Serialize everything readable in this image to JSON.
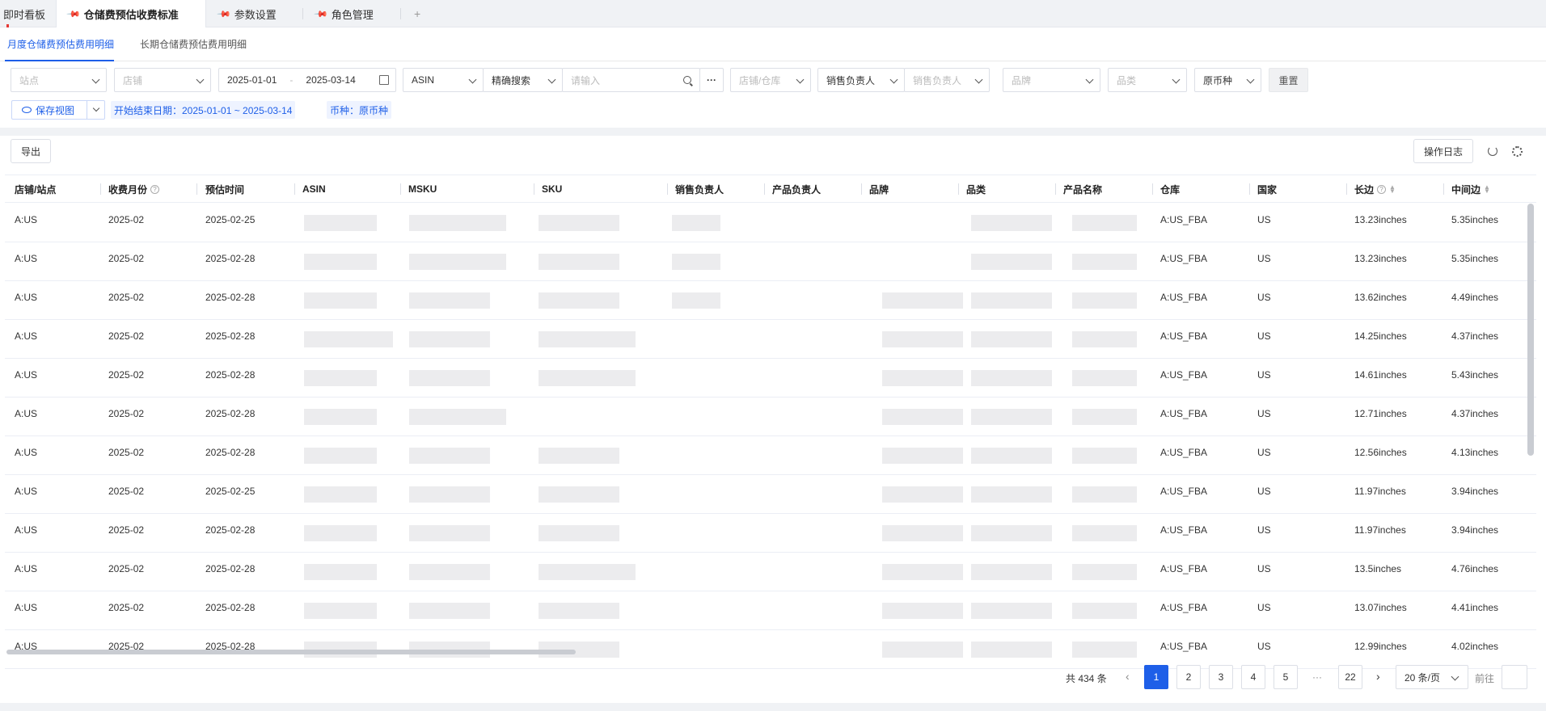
{
  "top_tabs": [
    {
      "label": "即时看板"
    },
    {
      "label": "仓储费预估收费标准"
    },
    {
      "label": "参数设置"
    },
    {
      "label": "角色管理"
    }
  ],
  "add_tab": "+",
  "sub_tabs": [
    {
      "label": "月度仓储费预估费用明细"
    },
    {
      "label": "长期仓储费预估费用明细"
    }
  ],
  "filters": {
    "site_placeholder": "站点",
    "shop_placeholder": "店铺",
    "date_start": "2025-01-01",
    "date_sep": "-",
    "date_end": "2025-03-14",
    "id_type": "ASIN",
    "match_mode": "精确搜索",
    "search_placeholder": "请输入",
    "more": "···",
    "shop_warehouse_placeholder": "店铺/仓库",
    "sales_owner_type": "销售负责人",
    "sales_owner_placeholder": "销售负责人",
    "brand_placeholder": "品牌",
    "category_placeholder": "品类",
    "currency": "原币种",
    "reset_label": "重置"
  },
  "view": {
    "save_view_label": "保存视图",
    "tag_date": "开始结束日期：2025-01-01 ~ 2025-03-14",
    "tag_currency": "币种：原币种"
  },
  "toolbar": {
    "export_label": "导出",
    "log_label": "操作日志"
  },
  "table": {
    "columns": [
      "店铺/站点",
      "收费月份",
      "预估时间",
      "ASIN",
      "MSKU",
      "SKU",
      "销售负责人",
      "产品负责人",
      "品牌",
      "品类",
      "产品名称",
      "仓库",
      "国家",
      "长边",
      "中间边"
    ],
    "rows": [
      {
        "shop": "A:US",
        "month": "2025-02",
        "date": "2025-02-25",
        "warehouse": "A:US_FBA",
        "country": "US",
        "long_side": "13.23inches",
        "mid_side": "5.35inches"
      },
      {
        "shop": "A:US",
        "month": "2025-02",
        "date": "2025-02-28",
        "warehouse": "A:US_FBA",
        "country": "US",
        "long_side": "13.23inches",
        "mid_side": "5.35inches"
      },
      {
        "shop": "A:US",
        "month": "2025-02",
        "date": "2025-02-28",
        "warehouse": "A:US_FBA",
        "country": "US",
        "long_side": "13.62inches",
        "mid_side": "4.49inches"
      },
      {
        "shop": "A:US",
        "month": "2025-02",
        "date": "2025-02-28",
        "warehouse": "A:US_FBA",
        "country": "US",
        "long_side": "14.25inches",
        "mid_side": "4.37inches"
      },
      {
        "shop": "A:US",
        "month": "2025-02",
        "date": "2025-02-28",
        "warehouse": "A:US_FBA",
        "country": "US",
        "long_side": "14.61inches",
        "mid_side": "5.43inches"
      },
      {
        "shop": "A:US",
        "month": "2025-02",
        "date": "2025-02-28",
        "warehouse": "A:US_FBA",
        "country": "US",
        "long_side": "12.71inches",
        "mid_side": "4.37inches"
      },
      {
        "shop": "A:US",
        "month": "2025-02",
        "date": "2025-02-28",
        "warehouse": "A:US_FBA",
        "country": "US",
        "long_side": "12.56inches",
        "mid_side": "4.13inches"
      },
      {
        "shop": "A:US",
        "month": "2025-02",
        "date": "2025-02-25",
        "warehouse": "A:US_FBA",
        "country": "US",
        "long_side": "11.97inches",
        "mid_side": "3.94inches"
      },
      {
        "shop": "A:US",
        "month": "2025-02",
        "date": "2025-02-28",
        "warehouse": "A:US_FBA",
        "country": "US",
        "long_side": "11.97inches",
        "mid_side": "3.94inches"
      },
      {
        "shop": "A:US",
        "month": "2025-02",
        "date": "2025-02-28",
        "warehouse": "A:US_FBA",
        "country": "US",
        "long_side": "13.5inches",
        "mid_side": "4.76inches"
      },
      {
        "shop": "A:US",
        "month": "2025-02",
        "date": "2025-02-28",
        "warehouse": "A:US_FBA",
        "country": "US",
        "long_side": "13.07inches",
        "mid_side": "4.41inches"
      },
      {
        "shop": "A:US",
        "month": "2025-02",
        "date": "2025-02-28",
        "warehouse": "A:US_FBA",
        "country": "US",
        "long_side": "12.99inches",
        "mid_side": "4.02inches"
      }
    ]
  },
  "pagination": {
    "total": "共 434 条",
    "prev": "‹",
    "pages": [
      "1",
      "2",
      "3",
      "4",
      "5"
    ],
    "ellipsis": "···",
    "last": "22",
    "next": "›",
    "page_size": "20 条/页",
    "goto_label": "前往"
  },
  "colors": {
    "accent": "#1e5fe8"
  }
}
